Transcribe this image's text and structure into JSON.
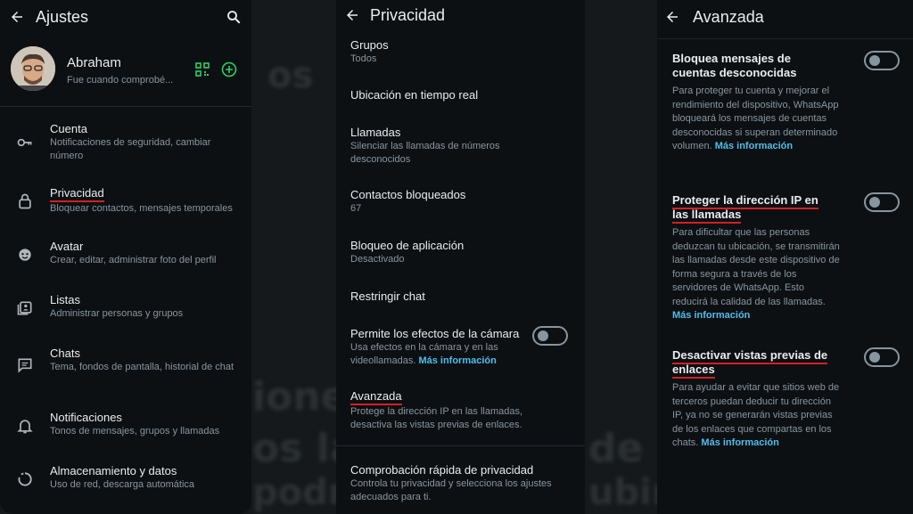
{
  "settings": {
    "title": "Ajustes",
    "profile": {
      "name": "Abraham",
      "status": "Fue cuando comprobé..."
    },
    "items": [
      {
        "title": "Cuenta",
        "subtitle": "Notificaciones de seguridad, cambiar número",
        "icon": "key-icon"
      },
      {
        "title": "Privacidad",
        "subtitle": "Bloquear contactos, mensajes temporales",
        "icon": "lock-icon"
      },
      {
        "title": "Avatar",
        "subtitle": "Crear, editar, administrar foto del perfil",
        "icon": "avatar-icon"
      },
      {
        "title": "Listas",
        "subtitle": "Administrar personas y grupos",
        "icon": "contacts-list-icon"
      },
      {
        "title": "Chats",
        "subtitle": "Tema, fondos de pantalla, historial de chat",
        "icon": "chat-icon"
      },
      {
        "title": "Notificaciones",
        "subtitle": "Tonos de mensajes, grupos y llamadas",
        "icon": "bell-icon"
      },
      {
        "title": "Almacenamiento y datos",
        "subtitle": "Uso de red, descarga automática",
        "icon": "storage-icon"
      }
    ]
  },
  "privacy": {
    "title": "Privacidad",
    "items": [
      {
        "title": "Grupos",
        "subtitle": "Todos"
      },
      {
        "title": "Ubicación en tiempo real",
        "subtitle": ""
      },
      {
        "title": "Llamadas",
        "subtitle": "Silenciar las llamadas de números desconocidos"
      },
      {
        "title": "Contactos bloqueados",
        "subtitle": "67"
      },
      {
        "title": "Bloqueo de aplicación",
        "subtitle": "Desactivado"
      },
      {
        "title": "Restringir chat",
        "subtitle": ""
      },
      {
        "title": "Permite los efectos de la cámara",
        "subtitle": "Usa efectos en la cámara y en las videollamadas.",
        "link": "Más información",
        "toggle": "off"
      },
      {
        "title": "Avanzada",
        "subtitle": "Protege la dirección IP en las llamadas, desactiva las vistas previas de enlaces."
      },
      {
        "title": "Comprobación rápida de privacidad",
        "subtitle": "Controla tu privacidad y selecciona los ajustes adecuados para ti."
      }
    ]
  },
  "advanced": {
    "title": "Avanzada",
    "items": [
      {
        "title": "Bloquea mensajes de cuentas desconocidas",
        "desc": "Para proteger tu cuenta y mejorar el rendimiento del dispositivo, WhatsApp bloqueará los mensajes de cuentas desconocidas si superan determinado volumen.",
        "link": "Más información",
        "toggle": "off"
      },
      {
        "title": "Proteger la dirección IP en las llamadas",
        "desc": "Para dificultar que las personas deduzcan tu ubicación, se transmitirán las llamadas desde este dispositivo de forma segura a través de los servidores de WhatsApp. Esto reducirá la calidad de las llamadas.",
        "link": "Más información",
        "toggle": "off"
      },
      {
        "title": "Desactivar vistas previas de enlaces",
        "desc": "Para ayudar a evitar que sitios web de terceros puedan deducir tu dirección IP, ya no se generarán vistas previas de los enlaces que compartas en los chats.",
        "link": "Más información",
        "toggle": "off"
      }
    ]
  },
  "colors": {
    "accent_green": "#25d366",
    "link_blue": "#53bdeb",
    "highlight_red": "#d61f1f",
    "panel_bg": "#0d1013"
  }
}
